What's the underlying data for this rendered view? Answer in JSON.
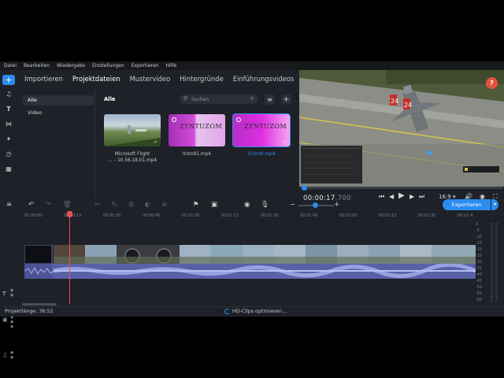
{
  "menu": [
    "Datei",
    "Bearbeiten",
    "Wiedergabe",
    "Einstellungen",
    "Exportieren",
    "Hilfe"
  ],
  "tabs": [
    "Importieren",
    "Projektdateien",
    "Mustervideo",
    "Hintergründe",
    "Einführungsvideos"
  ],
  "active_tab": "Projektdateien",
  "categories": [
    "Alle",
    "Video"
  ],
  "media": {
    "title": "Alle",
    "search_placeholder": "Suchen",
    "items": [
      {
        "caption_line1": "Microsoft Flight",
        "caption_line2": "... – 10.56.18.01.mp4",
        "selected": false
      },
      {
        "caption_line1": "Intro91.mp4",
        "caption_line2": "",
        "selected": false,
        "logo": "ZYNTUZOM"
      },
      {
        "caption_line1": "Outro9.mp4",
        "caption_line2": "",
        "selected": true,
        "logo": "ZYNTUZOM"
      }
    ]
  },
  "preview": {
    "help_label": "?",
    "time_main": "00:00:17",
    "time_ms": ".700",
    "aspect_ratio": "16:9",
    "progress_fraction": 0.02,
    "tail_numbers": [
      "24",
      "24"
    ]
  },
  "export": {
    "label": "Exportieren"
  },
  "ruler_ticks": [
    "00:00:00",
    "00:00:15",
    "00:00:30",
    "00:00:45",
    "00:01:00",
    "00:01:15",
    "00:01:30",
    "00:01:45",
    "00:02:00",
    "00:02:15",
    "00:02:30",
    "00:02:4"
  ],
  "meter_labels": [
    "0",
    "-5",
    "-10",
    "-15",
    "-20",
    "-25",
    "-30",
    "-35",
    "-40",
    "-45",
    "-50",
    "-55",
    "-60"
  ],
  "status": {
    "project_length": "Projektlänge: 36:52",
    "hd_message": "HD-Clips optimieren..."
  },
  "colors": {
    "accent": "#2b8cf0",
    "playhead": "#e25252",
    "audio": "#5861a8",
    "help": "#e2533e"
  },
  "icons": [
    "plus-icon",
    "music-icon",
    "text-icon",
    "transitions-icon",
    "filters-icon",
    "clock-icon",
    "grid-icon",
    "search-icon",
    "sort-icon",
    "undo-icon",
    "redo-icon",
    "trash-icon",
    "cut-icon",
    "rotate-icon",
    "crop-icon",
    "color-icon",
    "list-icon",
    "flag-icon",
    "image-icon",
    "marker-icon",
    "mic-icon",
    "volume-icon",
    "fullscreen-icon"
  ]
}
